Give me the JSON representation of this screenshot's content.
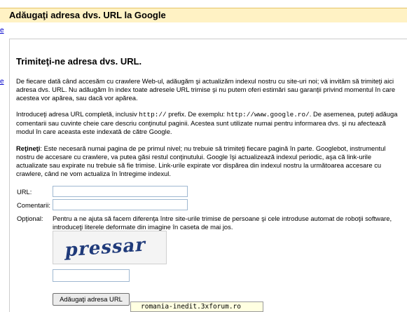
{
  "header": {
    "title": "Adăugaţi adresa dvs. URL la Google"
  },
  "edge_links": {
    "link1": "e",
    "link2": "e"
  },
  "section": {
    "title": "Trimiteţi-ne adresa dvs. URL."
  },
  "para1": {
    "text": "De fiecare dată când accesăm cu crawlere Web-ul, adăugăm şi actualizăm indexul nostru cu site-uri noi; vă invităm să trimiteţi aici adresa dvs. URL. Nu adăugăm în index toate adresele URL trimise şi nu putem oferi estimări sau garanţii privind momentul în care acestea vor apărea, sau dacă vor apărea."
  },
  "para2": {
    "part1": "Introduceţi adresa URL completă, inclusiv ",
    "code1": "http://",
    "part2": " prefix. De exemplu: ",
    "code2": "http://www.google.ro/",
    "part3": ". De asemenea, puteţi adăuga comentarii sau cuvinte cheie care descriu conţinutul paginii. Acestea sunt utilizate numai pentru informarea dvs. şi nu afectează modul în care aceasta este indexată de către Google."
  },
  "para3": {
    "bold": "Reţineţi",
    "text": ": Este necesară numai pagina de pe primul nivel; nu trebuie să trimiteţi fiecare pagină în parte. Googlebot, instrumentul nostru de accesare cu crawlere, va putea găsi restul conţinutului. Google îşi actualizează indexul periodic, aşa că link-urile actualizate sau expirate nu trebuie să fie trimise. Link-urile expirate vor dispărea din indexul nostru la următoarea accesare cu crawlere, când ne vom actualiza în întregime indexul."
  },
  "form": {
    "url_label": "URL:",
    "url_value": "",
    "comments_label": "Comentarii:",
    "comments_value": "",
    "optional_label": "Opţional:",
    "optional_text": "Pentru a ne ajuta să facem diferenţa între site-urile trimise de persoane şi cele introduse automat de roboţii software, introduceţi literele deformate din imagine în caseta de mai jos.",
    "captcha_text": "pressar",
    "captcha_value": "",
    "submit_label": "Adăugaţi adresa URL"
  },
  "status_tooltip": "romania-inedit.3xforum.ro",
  "colors": {
    "header_bg": "#fff2c4",
    "link": "#0000cc",
    "input_border": "#9fb8d1",
    "captcha_ink": "#1f3a7a"
  }
}
